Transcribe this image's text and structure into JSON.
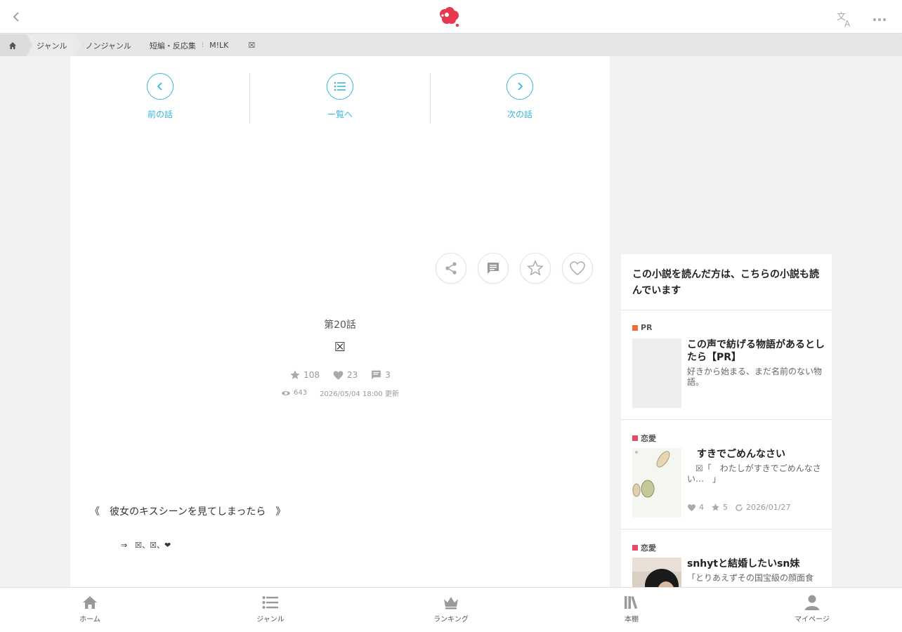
{
  "breadcrumb": {
    "items": [
      "ジャンル",
      "ノンジャンル",
      "短編・反応集",
      "M!LK",
      "☒"
    ],
    "separator": "⁝"
  },
  "nav": {
    "prev": "前の話",
    "list": "一覧へ",
    "next": "次の話"
  },
  "episode": {
    "number": "第20話",
    "title": "☒",
    "stars": "108",
    "likes": "23",
    "comments": "3",
    "views": "643",
    "updated": "2026/05/04 18:00 更新"
  },
  "body": {
    "line1": "《　彼女のキスシーンを見てしまったら　》",
    "line2": "⇒　☒、☒、❤︎"
  },
  "side": {
    "heading": "この小説を読んだ方は、こちらの小説も読んでいます",
    "cards": [
      {
        "category": "PR",
        "title": "この声で紡げる物語があるとしたら【PR】",
        "desc": "好きから始まる、まだ名前のない物語。"
      },
      {
        "category": "恋愛",
        "title": "　すきでごめんなさい",
        "desc": "　☒「　わたしがすきでごめんなさい…　」",
        "likes": "4",
        "stars": "5",
        "date": "2026/01/27"
      },
      {
        "category": "恋愛",
        "title": "snhytと結婚したいsn妹",
        "desc": "「とりあえずその国宝級の顔面食"
      }
    ]
  },
  "tabs": [
    "ホーム",
    "ジャンル",
    "ランキング",
    "本棚",
    "マイページ"
  ],
  "colors": {
    "accent": "#3ab5dc",
    "brand": "#e8384f",
    "pr": "#ee6d34",
    "romance": "#e84a6a"
  }
}
